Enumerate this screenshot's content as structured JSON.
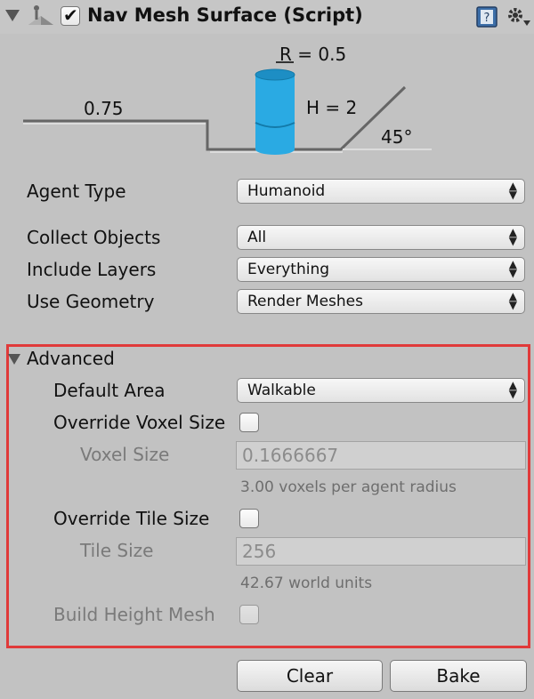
{
  "header": {
    "title": "Nav Mesh Surface (Script)",
    "enabled": true
  },
  "diagram": {
    "radius_label": "R = 0.5",
    "height_label": "H = 2",
    "step_label": "0.75",
    "slope_label": "45°",
    "cylinder_color": "#2aaae3"
  },
  "fields": {
    "agent_type": {
      "label": "Agent Type",
      "value": "Humanoid"
    },
    "collect_objects": {
      "label": "Collect Objects",
      "value": "All"
    },
    "include_layers": {
      "label": "Include Layers",
      "value": "Everything"
    },
    "use_geometry": {
      "label": "Use Geometry",
      "value": "Render Meshes"
    }
  },
  "advanced": {
    "label": "Advanced",
    "expanded": true,
    "default_area": {
      "label": "Default Area",
      "value": "Walkable"
    },
    "override_voxel_size": {
      "label": "Override Voxel Size",
      "checked": false
    },
    "voxel_size": {
      "label": "Voxel Size",
      "value": "0.1666667",
      "hint": "3.00 voxels per agent radius"
    },
    "override_tile_size": {
      "label": "Override Tile Size",
      "checked": false
    },
    "tile_size": {
      "label": "Tile Size",
      "value": "256",
      "hint": "42.67 world units"
    },
    "build_height_mesh": {
      "label": "Build Height Mesh",
      "checked": false
    }
  },
  "buttons": {
    "clear": "Clear",
    "bake": "Bake"
  },
  "colors": {
    "highlight_border": "#e03a3a",
    "panel_bg": "#c2c2c2"
  }
}
